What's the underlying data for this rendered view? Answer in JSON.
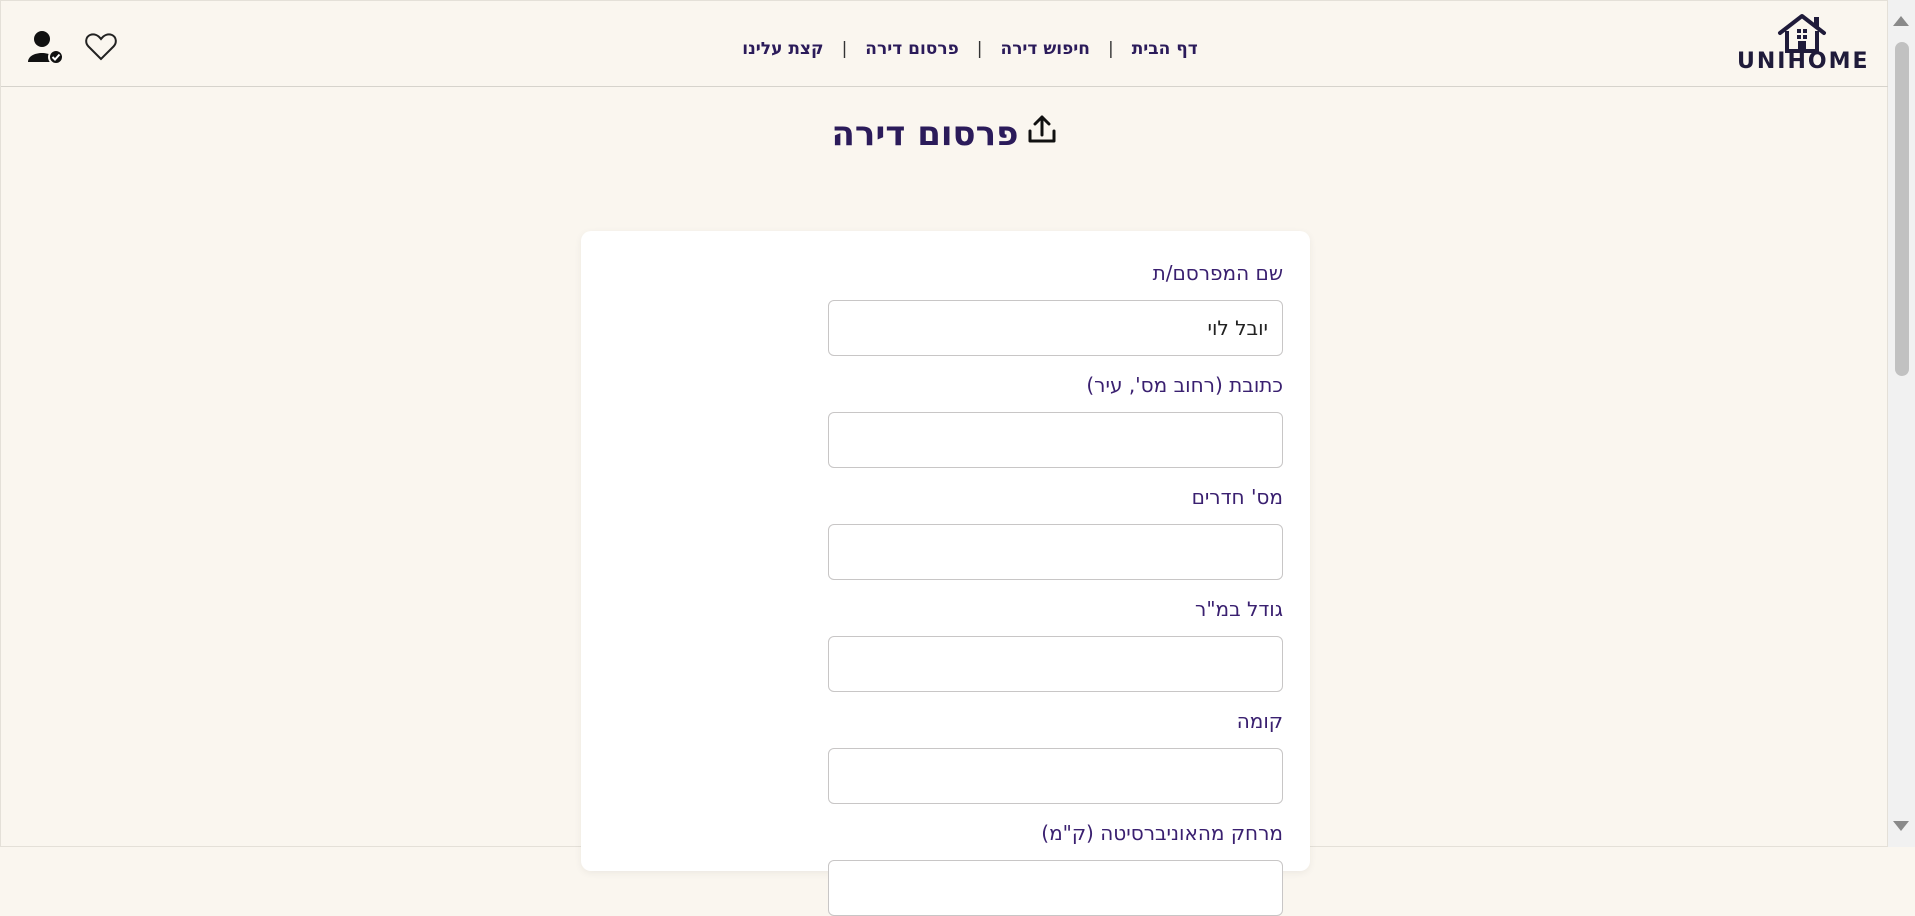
{
  "header": {
    "logo_text": "UNIHOME",
    "nav": [
      {
        "label": "דף הבית"
      },
      {
        "label": "חיפוש דירה"
      },
      {
        "label": "פרסום דירה"
      },
      {
        "label": "קצת עלינו"
      }
    ],
    "separator": "|",
    "icons": [
      "user-check-icon",
      "heart-icon"
    ]
  },
  "page": {
    "title": "פרסום דירה",
    "title_icon": "upload-icon"
  },
  "form": {
    "fields": [
      {
        "label": "שם המפרסם/ת",
        "value": "יובל לוי"
      },
      {
        "label": "כתובת (רחוב מס', עיר)",
        "value": ""
      },
      {
        "label": "מס' חדרים",
        "value": ""
      },
      {
        "label": "גודל במ\"ר",
        "value": ""
      },
      {
        "label": "קומה",
        "value": ""
      },
      {
        "label": "מרחק מהאוניברסיטה (ק\"מ)",
        "value": ""
      }
    ]
  },
  "colors": {
    "background": "#faf6ef",
    "accent": "#2b1b5a",
    "label": "#3a2070"
  }
}
